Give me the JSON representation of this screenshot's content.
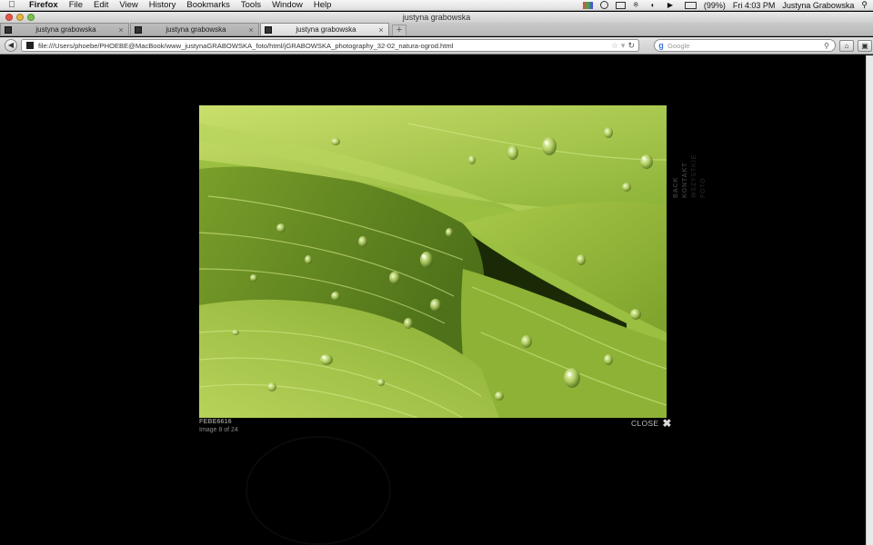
{
  "menubar": {
    "app": "Firefox",
    "items": [
      "File",
      "Edit",
      "View",
      "History",
      "Bookmarks",
      "Tools",
      "Window",
      "Help"
    ],
    "battery": "(99%)",
    "clock": "Fri 4:03 PM",
    "user": "Justyna Grabowska"
  },
  "window": {
    "title": "justyna grabowska"
  },
  "tabs": [
    {
      "label": "justyna grabowska"
    },
    {
      "label": "justyna grabowska"
    },
    {
      "label": "justyna grabowska"
    }
  ],
  "nav": {
    "url": "file:///Users/phoebe/PHOEBE@MacBook/www_justynaGRABOWSKA_foto/html/jGRABOWSKA_photography_32-02_natura-ogrod.html",
    "search_placeholder": "Google",
    "search_engine_glyph": "g"
  },
  "lightbox": {
    "image_id": "FEBE6616",
    "counter": "Image 8 of 24",
    "close_label": "CLOSE",
    "side_links": [
      "BACK",
      "KONTAKT",
      "WSZYSTKIE",
      "FOTO"
    ]
  },
  "colors": {
    "page_bg": "#000000",
    "leaf_light": "#b7d35a",
    "leaf_mid": "#7fa52c",
    "leaf_dark": "#3d5a15"
  }
}
